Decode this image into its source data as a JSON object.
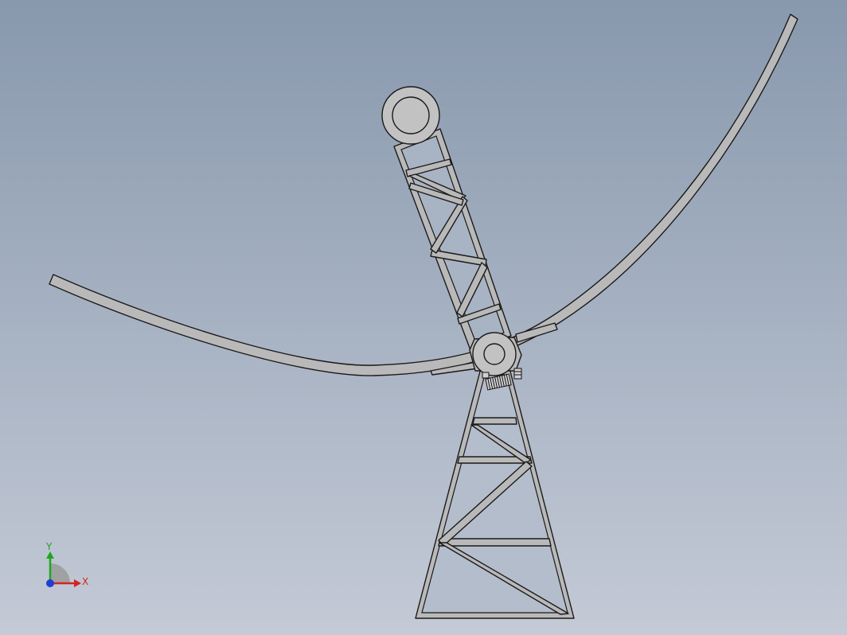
{
  "scene": {
    "model_description_hidden": false
  },
  "triad": {
    "x_label": "X",
    "y_label": "Y",
    "x_color": "#d42424",
    "y_color": "#1fa51f",
    "z_color": "#1f3fd4"
  },
  "colors": {
    "background_top": "#8898ad",
    "background_bottom": "#c4cad6",
    "part_fill": "#b9b9b9",
    "edge": "#1a1a1a"
  }
}
